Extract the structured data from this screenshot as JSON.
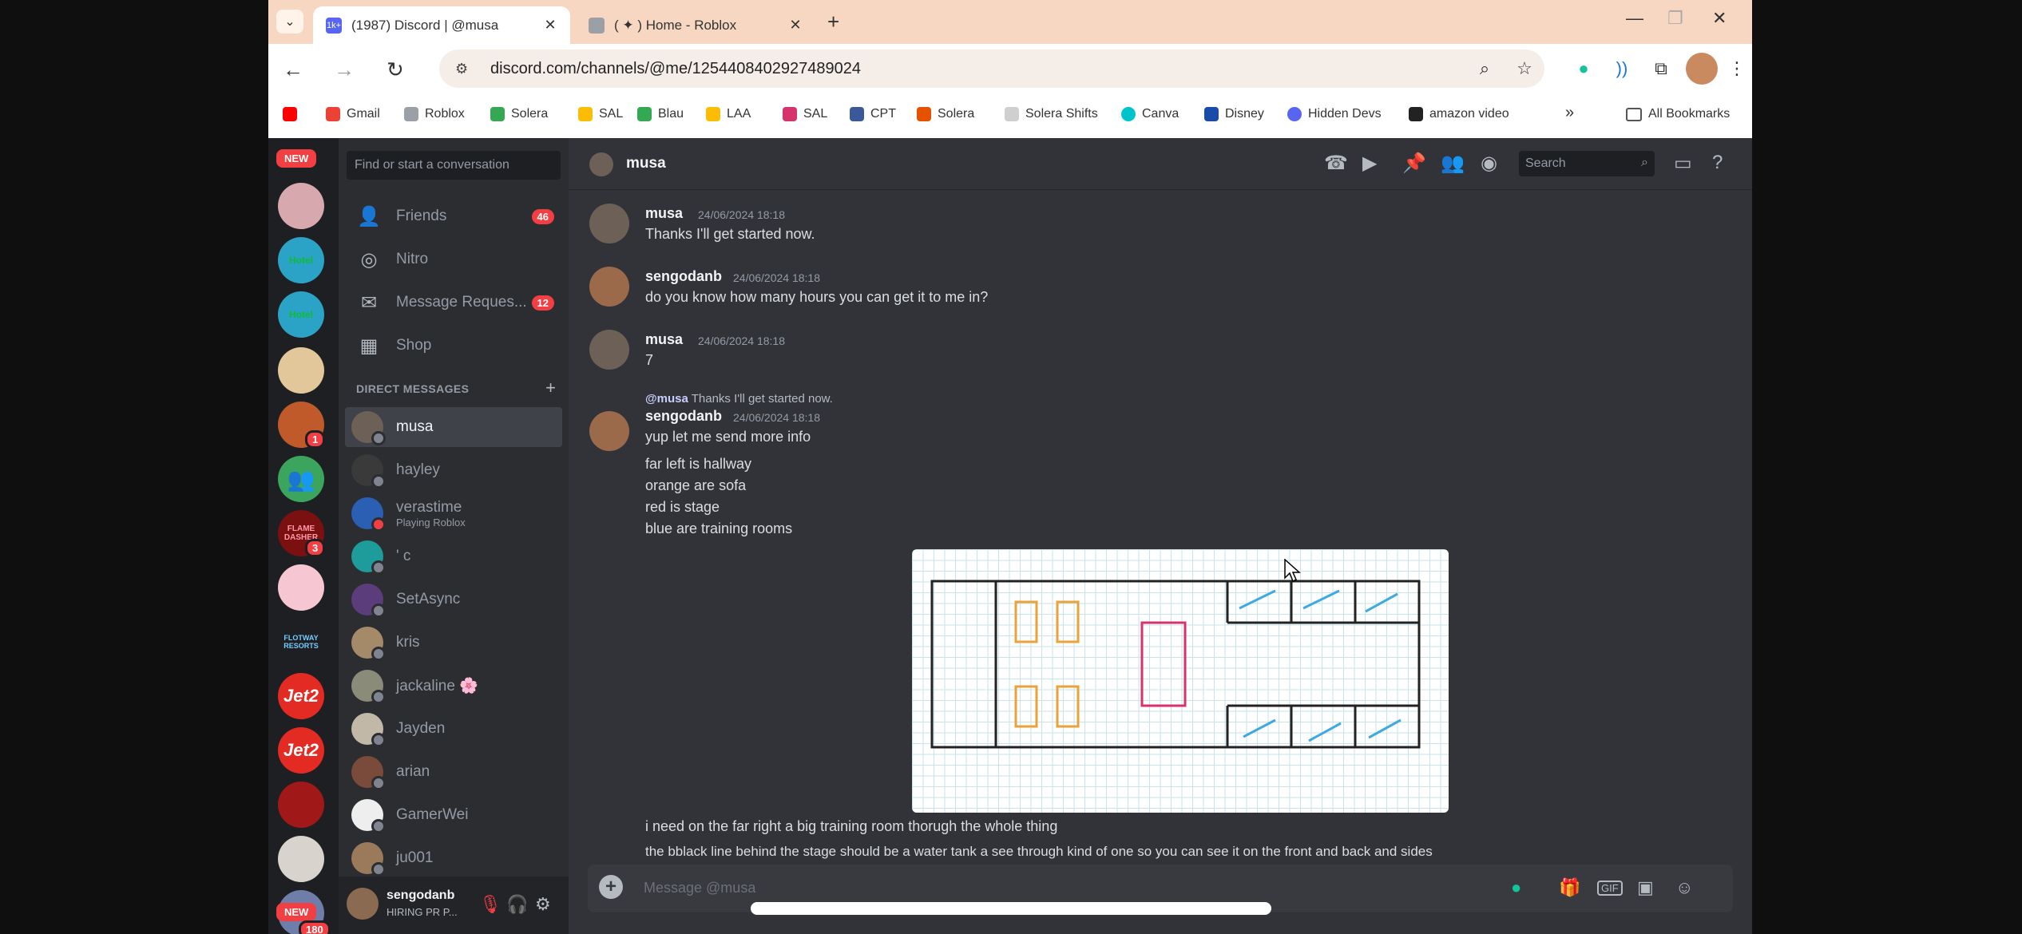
{
  "browser": {
    "tabs": [
      {
        "title": "(1987) Discord | @musa",
        "favicon_badge": "1k+"
      },
      {
        "title": "( ✦ ) Home - Roblox"
      }
    ],
    "url": "discord.com/channels/@me/1254408402927489024",
    "bookmarks": [
      "Gmail",
      "Roblox",
      "Solera",
      "SAL",
      "Blau",
      "LAA",
      "SAL",
      "CPT",
      "Solera",
      "Solera Shifts",
      "Canva",
      "Disney",
      "Hidden Devs",
      "amazon video"
    ],
    "all_bookmarks_label": "All Bookmarks"
  },
  "guilds": {
    "new_label": "NEW",
    "badges": [
      "1",
      "3"
    ],
    "bottom_new_label": "NEW",
    "bottom_count": "180",
    "labels": [
      "Hotel",
      "Hotel",
      "FLAME DASHER",
      "FLOTWAY RESORTS",
      "Jet2",
      "Jet2"
    ]
  },
  "sidebar": {
    "search_placeholder": "Find or start a conversation",
    "items": [
      {
        "label": "Friends",
        "count": "46",
        "icon": "friends-icon"
      },
      {
        "label": "Nitro",
        "icon": "nitro-icon"
      },
      {
        "label": "Message Reques...",
        "count": "12",
        "icon": "mail-icon"
      },
      {
        "label": "Shop",
        "icon": "shop-icon"
      }
    ],
    "dm_header": "DIRECT MESSAGES",
    "dms": [
      {
        "name": "musa"
      },
      {
        "name": "hayley"
      },
      {
        "name": "verastime",
        "activity": "Playing Roblox"
      },
      {
        "name": "' c"
      },
      {
        "name": "SetAsync"
      },
      {
        "name": "kris"
      },
      {
        "name": "jackaline 🌸"
      },
      {
        "name": "Jayden"
      },
      {
        "name": "arian"
      },
      {
        "name": "GamerWei"
      },
      {
        "name": "ju001"
      }
    ],
    "user": {
      "name": "sengodanb",
      "status": "HIRING PR P..."
    }
  },
  "chat": {
    "header_name": "musa",
    "search_placeholder": "Search",
    "messages": [
      {
        "author": "musa",
        "time": "24/06/2024 18:18",
        "lines": [
          "Thanks I'll get started now."
        ]
      },
      {
        "author": "sengodanb",
        "time": "24/06/2024 18:18",
        "lines": [
          "do you know how many hours you can get it to me in?"
        ]
      },
      {
        "author": "musa",
        "time": "24/06/2024 18:18",
        "lines": [
          "7"
        ]
      },
      {
        "author": "sengodanb",
        "time": "24/06/2024 18:18",
        "reply_to": "@musa",
        "reply_text": "Thanks I'll get started now.",
        "lines": [
          "yup let me send more info",
          "far left is hallway",
          "orange are sofa",
          "red is stage",
          "blue are training rooms"
        ]
      }
    ],
    "after_image": [
      "i need on the far right a big training room thorugh the whole thing",
      "the bblack line behind the stage should be a water tank a see through kind of one so you can see it on the front and back and sides"
    ],
    "composer_placeholder": "Message @musa"
  },
  "colors": {
    "accent_red": "#f23f43",
    "sofa": "#e8a33a",
    "stage": "#d6336c",
    "rooms": "#3fa9e0"
  }
}
